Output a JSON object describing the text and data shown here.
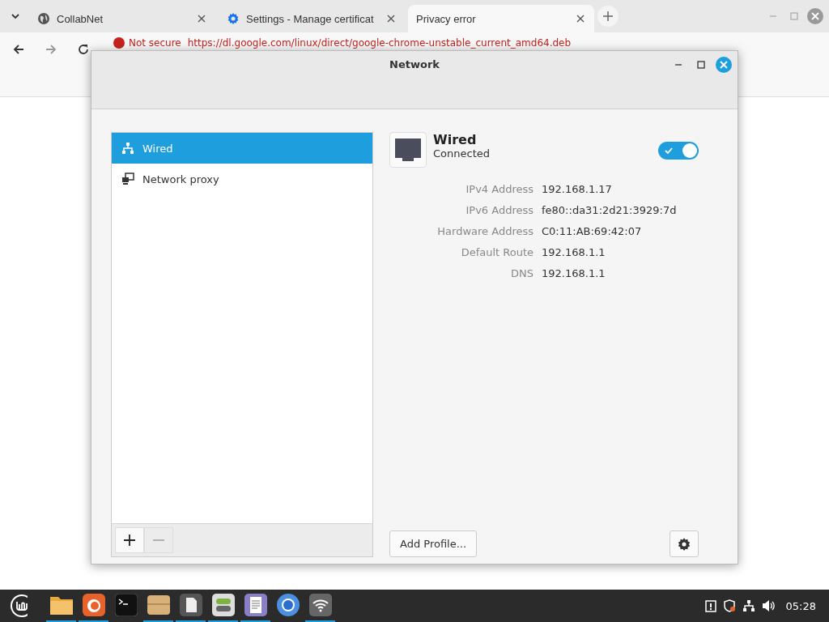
{
  "browser": {
    "tabs": [
      {
        "title": "CollabNet",
        "selected": false
      },
      {
        "title": "Settings - Manage certificat",
        "selected": false
      },
      {
        "title": "Privacy error",
        "selected": true
      }
    ],
    "address": {
      "security": "Not secure",
      "url": "https://dl.google.com/linux/direct/google-chrome-unstable_current_amd64.deb"
    }
  },
  "dialog": {
    "title": "Network",
    "sidebar": {
      "items": [
        {
          "label": "Wired",
          "kind": "wired",
          "selected": true
        },
        {
          "label": "Network proxy",
          "kind": "proxy",
          "selected": false
        }
      ]
    },
    "connection": {
      "title": "Wired",
      "status": "Connected",
      "on": true,
      "details": [
        {
          "label": "IPv4 Address",
          "value": "192.168.1.17"
        },
        {
          "label": "IPv6 Address",
          "value": "fe80::da31:2d21:3929:7d"
        },
        {
          "label": "Hardware Address",
          "value": "C0:11:AB:69:42:07"
        },
        {
          "label": "Default Route",
          "value": "192.168.1.1"
        },
        {
          "label": "DNS",
          "value": "192.168.1.1"
        }
      ]
    },
    "add_profile_button": "Add Profile..."
  },
  "taskbar": {
    "apps": [
      {
        "kind": "files",
        "running": true
      },
      {
        "kind": "firefox",
        "running": true
      },
      {
        "kind": "terminal",
        "running": false
      },
      {
        "kind": "archive",
        "running": true
      },
      {
        "kind": "document",
        "running": true
      },
      {
        "kind": "settings",
        "running": true
      },
      {
        "kind": "notes",
        "running": true
      },
      {
        "kind": "chrome",
        "running": false
      },
      {
        "kind": "network",
        "running": true
      }
    ],
    "clock": "05:28"
  }
}
